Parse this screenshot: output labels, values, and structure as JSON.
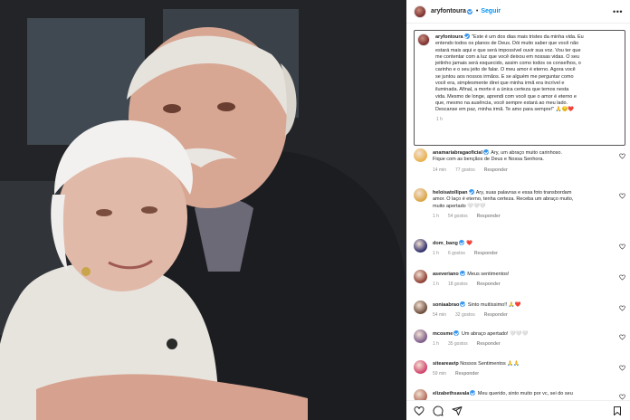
{
  "post": {
    "username": "aryfontoura",
    "follow_label": "Seguir",
    "more_icon": "ellipsis-icon",
    "caption_user": "aryfontoura",
    "caption_lines": [
      "\"Este é um dos dias mais tristes da minha vida. Eu",
      "entendo todos os planos de Deus. Dói muito saber que você não",
      "estará mais aqui e que será impossível ouvir sua voz. Vou ter que",
      "me contentar com a luz que você deixou em nossas vidas. O seu",
      "jeitinho jamais será esquecido, assim como todos os conselhos, o",
      "carinho e o seu jeito de falar. O meu amor é eterno. Agora você",
      "se juntou aos nossos irmãos. E se alguém me perguntar como",
      "você era, simplesmente direi que minha irmã era incrível e",
      "iluminada. Afinal, a morte é a única certeza que temos nesta",
      "vida. Mesmo de longe, aprendi com você que o amor é eterno e",
      "que, mesmo na ausência, você sempre estará ao meu lado.",
      "Descanse em paz, minha irmã. Te amo para sempre!\" 🙏😔❤️"
    ],
    "caption_time": "1 h"
  },
  "comments": [
    {
      "user": "anamariabragaoficial",
      "verified": true,
      "lines": [
        "Ary, um abraço muito carinhoso.",
        "Fique com as bençãos de Deus e Nossa Senhora."
      ],
      "time": "14 min",
      "likes": "77 gostos",
      "reply": "Responder",
      "avatar": "#e8b04a"
    },
    {
      "user": "heloisatollipan",
      "verified": true,
      "lines": [
        "Ary, suas palavras e essa foto transbordam",
        "amor. O laço é eterno, tenha certeza. Receba um abraço muito,",
        "muito apertado 🤍🤍🤍"
      ],
      "time": "1 h",
      "likes": "54 gostos",
      "reply": "Responder",
      "avatar": "#d9a441"
    },
    {
      "user": "dom_bang",
      "verified": true,
      "lines": [
        "❤️"
      ],
      "time": "1 h",
      "likes": "6 gostos",
      "reply": "Responder",
      "avatar": "#2b2b6a"
    },
    {
      "user": "aseveriano",
      "verified": true,
      "lines": [
        "Meus sentimentos!"
      ],
      "time": "1 h",
      "likes": "18 gostos",
      "reply": "Responder",
      "avatar": "#8a3b2f"
    },
    {
      "user": "soniaabrao",
      "verified": true,
      "lines": [
        "Sinto muitíssimo!! 🙏❤️"
      ],
      "time": "54 min",
      "likes": "32 gostos",
      "reply": "Responder",
      "avatar": "#6a4a3a"
    },
    {
      "user": "mcosme",
      "verified": true,
      "lines": [
        "Um abraço apertado! 🤍🤍🤍"
      ],
      "time": "1 h",
      "likes": "35 gostos",
      "reply": "Responder",
      "avatar": "#7a5a8a"
    },
    {
      "user": "siteareavip",
      "verified": false,
      "lines": [
        "Nossos Sentimentos 🙏🙏"
      ],
      "time": "59 min",
      "likes": "",
      "reply": "Responder",
      "avatar": "#d0406a"
    },
    {
      "user": "elizabethsavala",
      "verified": true,
      "lines": [
        "Meu querido, sinto muito por vc, sei do seu"
      ],
      "time": "",
      "likes": "",
      "reply": "",
      "avatar": "#b06a5a"
    }
  ],
  "colors": {
    "link": "#0095f6",
    "verified": "#3797f0",
    "muted": "#8e8e8e",
    "heart": "#ed4956"
  },
  "action_icons": [
    "heart-icon",
    "comment-icon",
    "share-icon",
    "bookmark-icon"
  ]
}
